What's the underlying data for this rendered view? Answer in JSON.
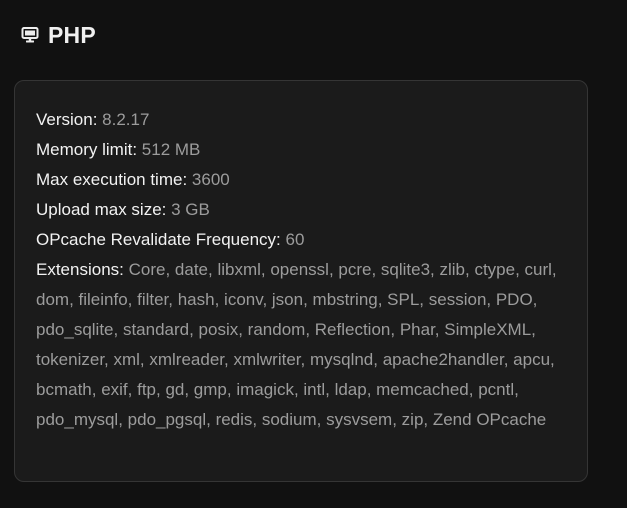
{
  "header": {
    "icon": "monitor-icon",
    "title": "PHP"
  },
  "info": {
    "version": {
      "label": "Version:",
      "value": "8.2.17"
    },
    "memory_limit": {
      "label": "Memory limit:",
      "value": "512 MB"
    },
    "max_execution_time": {
      "label": "Max execution time:",
      "value": "3600"
    },
    "upload_max_size": {
      "label": "Upload max size:",
      "value": "3 GB"
    },
    "opcache_revalidate_frequency": {
      "label": "OPcache Revalidate Frequency:",
      "value": "60"
    },
    "extensions": {
      "label": "Extensions:",
      "value": "Core, date, libxml, openssl, pcre, sqlite3, zlib, ctype, curl, dom, fileinfo, filter, hash, iconv, json, mbstring, SPL, session, PDO, pdo_sqlite, standard, posix, random, Reflection, Phar, SimpleXML, tokenizer, xml, xmlreader, xmlwriter, mysqlnd, apache2handler, apcu, bcmath, exif, ftp, gd, gmp, imagick, intl, ldap, memcached, pcntl, pdo_mysql, pdo_pgsql, redis, sodium, sysvsem, zip, Zend OPcache"
    }
  },
  "colors": {
    "background": "#111111",
    "card": "#1b1b1b",
    "border": "#353535",
    "label": "#f2f2f2",
    "value": "#9c9c9c"
  }
}
